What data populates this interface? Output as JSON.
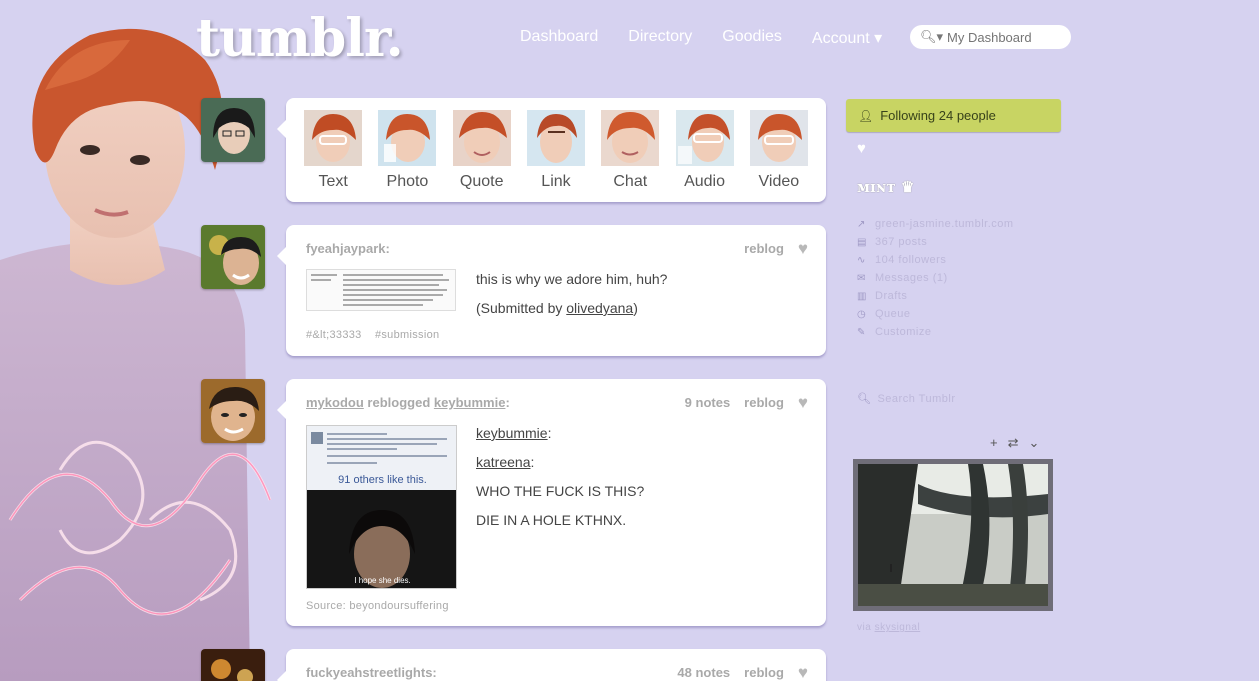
{
  "header": {
    "logo": "tumblr.",
    "nav": [
      "Dashboard",
      "Directory",
      "Goodies",
      "Account ▾"
    ],
    "search_placeholder": "My Dashboard"
  },
  "post_types": [
    "Text",
    "Photo",
    "Quote",
    "Link",
    "Chat",
    "Audio",
    "Video"
  ],
  "posts": [
    {
      "author": "fyeahjaypark:",
      "reblog": "reblog",
      "body": [
        "this is why we adore him, huh?",
        "(Submitted by ",
        "olivedyana",
        ")"
      ],
      "tags": [
        "#&lt;33333",
        "#submission"
      ]
    },
    {
      "author": "mykodou",
      "reblogged_text": "reblogged",
      "reblogged_from": "keybummie",
      "colon": ":",
      "notes": "9 notes",
      "reblog": "reblog",
      "lines": [
        "keybummie",
        "katreena",
        "WHO THE FUCK IS THIS?",
        "DIE IN A HOLE KTHNX."
      ],
      "image_caption_top": "91 others like this.",
      "image_caption_bottom": "I hope she dies.",
      "source_label": "Source:",
      "source": "beyondoursuffering"
    },
    {
      "author": "fuckyeahstreetlights:",
      "notes": "48 notes",
      "reblog": "reblog"
    }
  ],
  "sidebar": {
    "following": "Following 24 people",
    "title": "ᴍɪɴᴛ ♛",
    "items": [
      {
        "icon": "link-icon",
        "label": "green-jasmine.tumblr.com"
      },
      {
        "icon": "posts-icon",
        "label": "367 posts"
      },
      {
        "icon": "followers-icon",
        "label": "104 followers"
      },
      {
        "icon": "messages-icon",
        "label": "Messages (1)"
      },
      {
        "icon": "drafts-icon",
        "label": "Drafts"
      },
      {
        "icon": "queue-icon",
        "label": "Queue"
      },
      {
        "icon": "customize-icon",
        "label": "Customize"
      }
    ],
    "search": "Search Tumblr",
    "via_label": "via",
    "via": "skysignal"
  },
  "colors": {
    "background": "#d6d2f0",
    "follow_bg": "#c8d463"
  }
}
